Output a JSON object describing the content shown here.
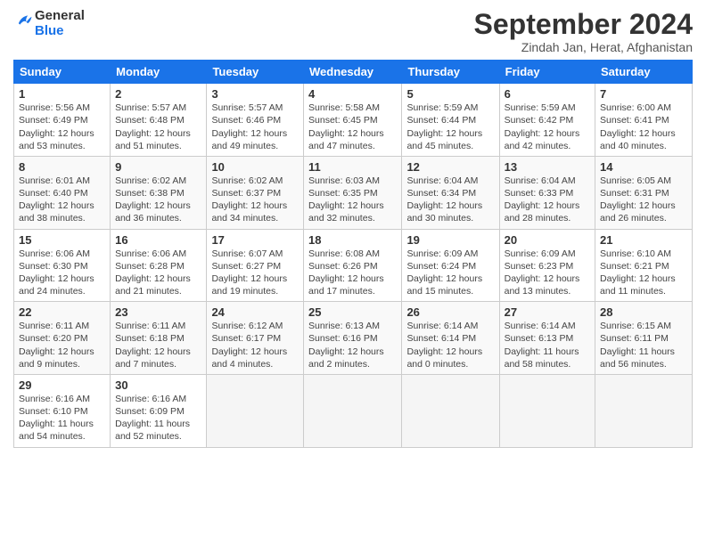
{
  "header": {
    "logo_general": "General",
    "logo_blue": "Blue",
    "month_title": "September 2024",
    "location": "Zindah Jan, Herat, Afghanistan"
  },
  "columns": [
    "Sunday",
    "Monday",
    "Tuesday",
    "Wednesday",
    "Thursday",
    "Friday",
    "Saturday"
  ],
  "weeks": [
    [
      {
        "day": "1",
        "detail": "Sunrise: 5:56 AM\nSunset: 6:49 PM\nDaylight: 12 hours\nand 53 minutes."
      },
      {
        "day": "2",
        "detail": "Sunrise: 5:57 AM\nSunset: 6:48 PM\nDaylight: 12 hours\nand 51 minutes."
      },
      {
        "day": "3",
        "detail": "Sunrise: 5:57 AM\nSunset: 6:46 PM\nDaylight: 12 hours\nand 49 minutes."
      },
      {
        "day": "4",
        "detail": "Sunrise: 5:58 AM\nSunset: 6:45 PM\nDaylight: 12 hours\nand 47 minutes."
      },
      {
        "day": "5",
        "detail": "Sunrise: 5:59 AM\nSunset: 6:44 PM\nDaylight: 12 hours\nand 45 minutes."
      },
      {
        "day": "6",
        "detail": "Sunrise: 5:59 AM\nSunset: 6:42 PM\nDaylight: 12 hours\nand 42 minutes."
      },
      {
        "day": "7",
        "detail": "Sunrise: 6:00 AM\nSunset: 6:41 PM\nDaylight: 12 hours\nand 40 minutes."
      }
    ],
    [
      {
        "day": "8",
        "detail": "Sunrise: 6:01 AM\nSunset: 6:40 PM\nDaylight: 12 hours\nand 38 minutes."
      },
      {
        "day": "9",
        "detail": "Sunrise: 6:02 AM\nSunset: 6:38 PM\nDaylight: 12 hours\nand 36 minutes."
      },
      {
        "day": "10",
        "detail": "Sunrise: 6:02 AM\nSunset: 6:37 PM\nDaylight: 12 hours\nand 34 minutes."
      },
      {
        "day": "11",
        "detail": "Sunrise: 6:03 AM\nSunset: 6:35 PM\nDaylight: 12 hours\nand 32 minutes."
      },
      {
        "day": "12",
        "detail": "Sunrise: 6:04 AM\nSunset: 6:34 PM\nDaylight: 12 hours\nand 30 minutes."
      },
      {
        "day": "13",
        "detail": "Sunrise: 6:04 AM\nSunset: 6:33 PM\nDaylight: 12 hours\nand 28 minutes."
      },
      {
        "day": "14",
        "detail": "Sunrise: 6:05 AM\nSunset: 6:31 PM\nDaylight: 12 hours\nand 26 minutes."
      }
    ],
    [
      {
        "day": "15",
        "detail": "Sunrise: 6:06 AM\nSunset: 6:30 PM\nDaylight: 12 hours\nand 24 minutes."
      },
      {
        "day": "16",
        "detail": "Sunrise: 6:06 AM\nSunset: 6:28 PM\nDaylight: 12 hours\nand 21 minutes."
      },
      {
        "day": "17",
        "detail": "Sunrise: 6:07 AM\nSunset: 6:27 PM\nDaylight: 12 hours\nand 19 minutes."
      },
      {
        "day": "18",
        "detail": "Sunrise: 6:08 AM\nSunset: 6:26 PM\nDaylight: 12 hours\nand 17 minutes."
      },
      {
        "day": "19",
        "detail": "Sunrise: 6:09 AM\nSunset: 6:24 PM\nDaylight: 12 hours\nand 15 minutes."
      },
      {
        "day": "20",
        "detail": "Sunrise: 6:09 AM\nSunset: 6:23 PM\nDaylight: 12 hours\nand 13 minutes."
      },
      {
        "day": "21",
        "detail": "Sunrise: 6:10 AM\nSunset: 6:21 PM\nDaylight: 12 hours\nand 11 minutes."
      }
    ],
    [
      {
        "day": "22",
        "detail": "Sunrise: 6:11 AM\nSunset: 6:20 PM\nDaylight: 12 hours\nand 9 minutes."
      },
      {
        "day": "23",
        "detail": "Sunrise: 6:11 AM\nSunset: 6:18 PM\nDaylight: 12 hours\nand 7 minutes."
      },
      {
        "day": "24",
        "detail": "Sunrise: 6:12 AM\nSunset: 6:17 PM\nDaylight: 12 hours\nand 4 minutes."
      },
      {
        "day": "25",
        "detail": "Sunrise: 6:13 AM\nSunset: 6:16 PM\nDaylight: 12 hours\nand 2 minutes."
      },
      {
        "day": "26",
        "detail": "Sunrise: 6:14 AM\nSunset: 6:14 PM\nDaylight: 12 hours\nand 0 minutes."
      },
      {
        "day": "27",
        "detail": "Sunrise: 6:14 AM\nSunset: 6:13 PM\nDaylight: 11 hours\nand 58 minutes."
      },
      {
        "day": "28",
        "detail": "Sunrise: 6:15 AM\nSunset: 6:11 PM\nDaylight: 11 hours\nand 56 minutes."
      }
    ],
    [
      {
        "day": "29",
        "detail": "Sunrise: 6:16 AM\nSunset: 6:10 PM\nDaylight: 11 hours\nand 54 minutes."
      },
      {
        "day": "30",
        "detail": "Sunrise: 6:16 AM\nSunset: 6:09 PM\nDaylight: 11 hours\nand 52 minutes."
      },
      {
        "day": "",
        "detail": ""
      },
      {
        "day": "",
        "detail": ""
      },
      {
        "day": "",
        "detail": ""
      },
      {
        "day": "",
        "detail": ""
      },
      {
        "day": "",
        "detail": ""
      }
    ]
  ]
}
